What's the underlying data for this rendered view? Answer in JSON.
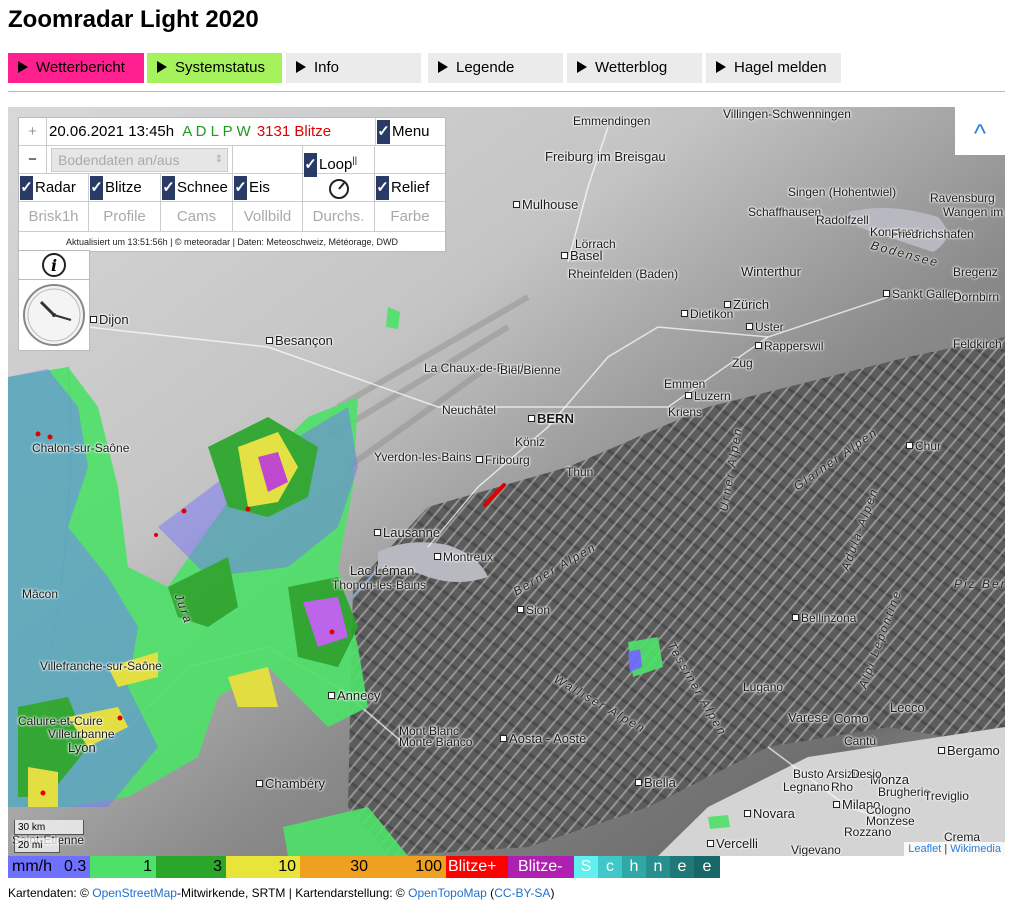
{
  "title": "Zoomradar Light 2020",
  "nav": [
    {
      "label": "Wetterbericht",
      "bg": "#ff1f8e"
    },
    {
      "label": "Systemstatus",
      "bg": "#a6f25c"
    },
    {
      "label": "Info",
      "bg": "#ebebeb"
    },
    {
      "label": "Legende",
      "bg": "#ebebeb"
    },
    {
      "label": "Wetterblog",
      "bg": "#ebebeb"
    },
    {
      "label": "Hagel melden",
      "bg": "#ebebeb"
    }
  ],
  "panel": {
    "zoom_in": "+",
    "zoom_out": "−",
    "datetime": "20.06.2021 13:45h",
    "sources": "A D L P W",
    "strikes": "3131 Blitze",
    "menu_label": "Menu",
    "bodendaten_label": "Bodendaten an/aus",
    "loop_label": "Loop",
    "loop_suffix": "||",
    "layers": {
      "radar": "Radar",
      "blitze": "Blitze",
      "schnee": "Schnee",
      "eis": "Eis",
      "relief": "Relief"
    },
    "row4": [
      "Brisk1h",
      "Profile",
      "Cams",
      "Vollbild",
      "Durchs.",
      "Farbe"
    ],
    "updated": "Aktualisiert um 13:51:56h | © meteoradar | Daten: Meteoschweiz, Météorage, DWD"
  },
  "map": {
    "zoom_top": "^",
    "scale_km": "30 km",
    "scale_mi": "20 mi",
    "attr_leaflet": "Leaflet",
    "attr_sep": " | ",
    "attr_wiki": "Wikimedia",
    "places": [
      "Villingen-Schwenningen",
      "Emmendingen",
      "Freiburg im Breisgau",
      "Mulhouse",
      "Singen (Hohentwiel)",
      "Ravensburg",
      "Wangen im Allgäu",
      "Schaffhausen",
      "Radolfzell",
      "Konstanz",
      "Friedrichshafen",
      "Basel",
      "Lörrach",
      "Rheinfelden (Baden)",
      "Winterthur",
      "Bregenz",
      "Zürich",
      "Dietikon",
      "Uster",
      "Sankt Gallen",
      "Dornbirn",
      "Dijon",
      "Besançon",
      "Rapperswil",
      "Feldkirch",
      "La Chaux-de-Fonds",
      "Biel/Bienne",
      "Zug",
      "Emmen",
      "Luzern",
      "Neuchâtel",
      "BERN",
      "Kriens",
      "Yverdon-les-Bains",
      "Köniz",
      "Fribourg",
      "Thun",
      "Chur",
      "Chalon-sur-Saône",
      "Lausanne",
      "Montreux",
      "Lac Léman",
      "Thonon-les-Bains",
      "Sion",
      "Bellinzona",
      "Mâcon",
      "Villefranche-sur-Saône",
      "Annecy",
      "Lugano",
      "Lecco",
      "Caluire-et-Cuire",
      "Villeurbanne",
      "Lyon",
      "Mont Blanc",
      "Monte Bianco",
      "Aosta - Aoste",
      "Varese",
      "Como",
      "Cantù",
      "Bergamo",
      "Chambéry",
      "Busto Arsizio",
      "Monza",
      "Legnano",
      "Rho",
      "Desio",
      "Brugherio",
      "Treviglio",
      "Biella",
      "Milano",
      "Cologno",
      "Monzese",
      "Novara",
      "Rozzano",
      "Crema",
      "Vercelli",
      "Vigevano",
      "Saint-Étienne",
      "Bodensee",
      "Piz Bernina"
    ],
    "regions": [
      "Berner Alpen",
      "Walliser Alpen",
      "Glarner Alpen",
      "Urner Alpen",
      "Adula-Alpen",
      "Alpi Lepontine",
      "Tessiner Alpen",
      "Jura"
    ]
  },
  "legend": {
    "unit": "mm/h",
    "bins": [
      "0.3",
      "1",
      "3",
      "10",
      "30",
      "100"
    ],
    "blitze_pos": "Blitze+",
    "blitze_neg": "Blitze-",
    "schnee_letters": [
      "S",
      "c",
      "h",
      "n",
      "e",
      "e"
    ],
    "colors": {
      "b1": "#7070ff",
      "b2": "#4fe06a",
      "b3": "#2aa62a",
      "b4": "#e8e43a",
      "b5": "#f0a020",
      "b6": "#ff0000",
      "b7": "#b020b0",
      "snow": [
        "#60f0f0",
        "#40c8c8",
        "#30a8a8",
        "#288f8f",
        "#207878",
        "#186868"
      ]
    }
  },
  "footer": {
    "prefix": "Kartendaten: © ",
    "osm": "OpenStreetMap",
    "mid": "-Mitwirkende, SRTM | Kartendarstellung: © ",
    "otm": "OpenTopoMap",
    "open_paren": " (",
    "license": "CC-BY-SA",
    "close_paren": ")"
  }
}
